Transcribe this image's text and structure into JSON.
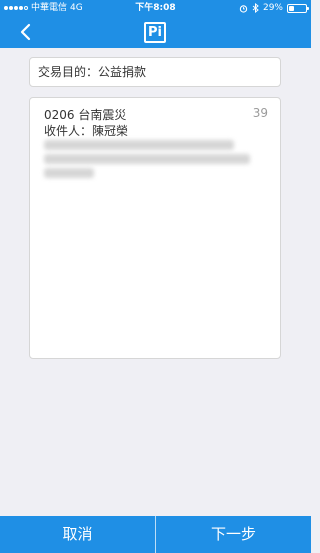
{
  "status_bar": {
    "carrier": "中華電信",
    "network": "4G",
    "time": "下午8:08",
    "battery_percent": "29%",
    "battery_level": 0.29,
    "icons": [
      "alarm-icon",
      "bluetooth-icon"
    ]
  },
  "nav": {
    "logo_text": "Pi",
    "back_icon": "chevron-left-icon"
  },
  "purpose": {
    "text": "交易目的：公益捐款"
  },
  "card": {
    "title": "0206 台南震災",
    "count": "39",
    "recipient": "收件人：陳冠榮"
  },
  "bottom": {
    "cancel_label": "取消",
    "next_label": "下一步"
  },
  "colors": {
    "primary": "#1f8fe5",
    "background": "#efeff4"
  }
}
